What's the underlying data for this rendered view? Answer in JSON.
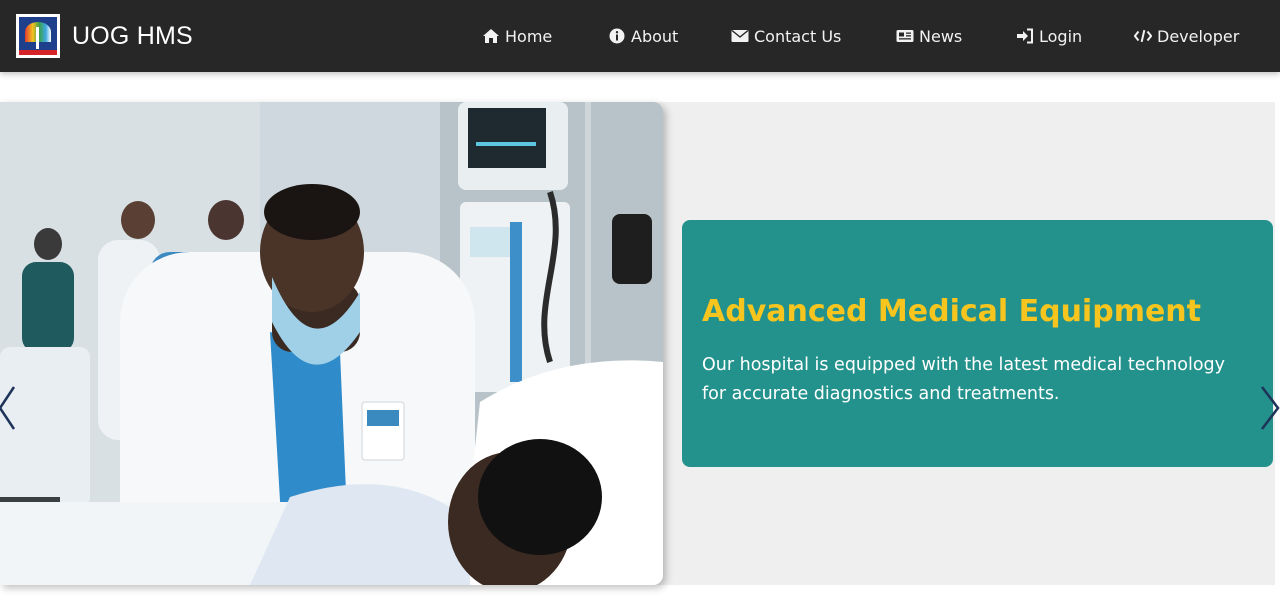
{
  "brand": {
    "name": "UOG HMS",
    "logo_icon": "university-logo"
  },
  "nav": [
    {
      "label": "Home",
      "icon": "home-icon"
    },
    {
      "label": "About",
      "icon": "info-icon"
    },
    {
      "label": "Contact Us",
      "icon": "envelope-icon"
    },
    {
      "label": "News",
      "icon": "newspaper-icon"
    },
    {
      "label": "Login",
      "icon": "sign-in-icon"
    },
    {
      "label": "Developer",
      "icon": "code-icon"
    }
  ],
  "carousel": {
    "image_description": "doctor-with-patient-photo",
    "caption": {
      "title": "Advanced Medical Equipment",
      "text": "Our hospital is equipped with the latest medical technology for accurate diagnostics and treatments."
    }
  },
  "colors": {
    "navbar": "#272727",
    "caption_bg": "#24928c",
    "caption_title": "#f7c51e",
    "carousel_bg": "#efefef"
  }
}
